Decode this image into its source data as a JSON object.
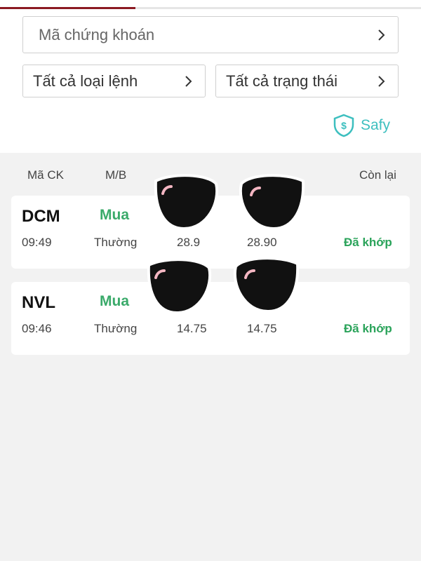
{
  "filters": {
    "stock_placeholder": "Mã chứng khoán",
    "order_type": "Tất cả loại lệnh",
    "status": "Tất cả trạng thái"
  },
  "safy": {
    "label": "Safy",
    "icon": "shield-dollar-icon",
    "color": "#3dbfbf"
  },
  "columns": {
    "ticker": "Mã CK",
    "side": "M/B",
    "remaining": "Còn lại"
  },
  "orders": [
    {
      "ticker": "DCM",
      "side": "Mua",
      "time": "09:49",
      "order_type": "Thường",
      "price": "28.9",
      "matched_price": "28.90",
      "status": "Đã khớp"
    },
    {
      "ticker": "NVL",
      "side": "Mua",
      "time": "09:46",
      "order_type": "Thường",
      "price": "14.75",
      "matched_price": "14.75",
      "status": "Đã khớp"
    }
  ],
  "colors": {
    "brand": "#8b1a22",
    "buy": "#3aaa6a",
    "matched": "#2aa35a"
  }
}
